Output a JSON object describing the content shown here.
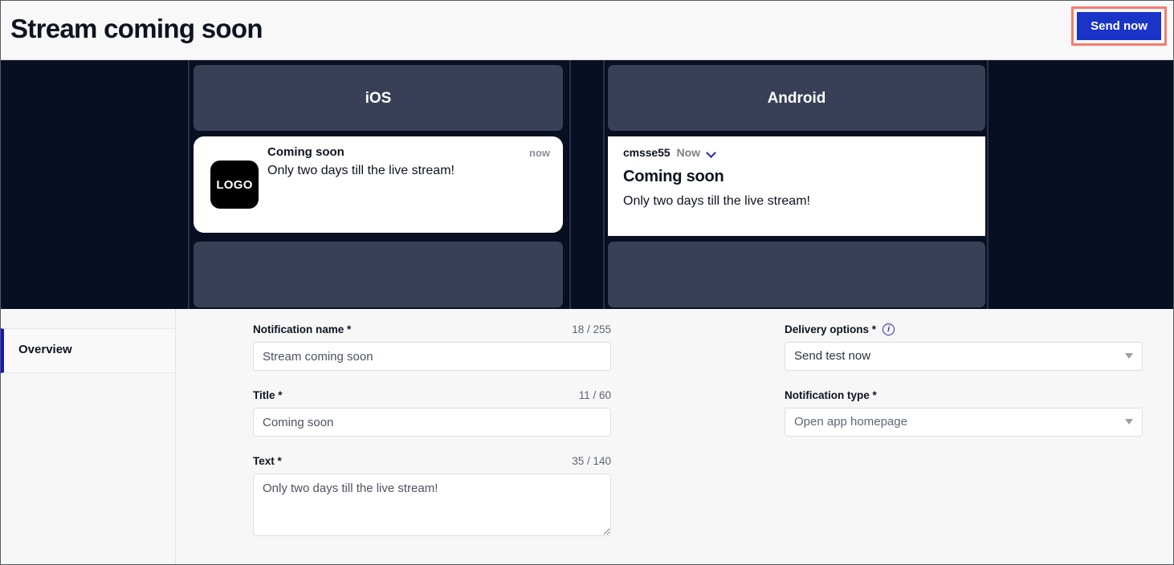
{
  "header": {
    "title": "Stream coming soon",
    "send_now_label": "Send now",
    "highlight_color": "#fa7a6e",
    "button_color": "#1a34c8"
  },
  "preview": {
    "ios": {
      "platform_label": "iOS",
      "logo_text": "LOGO",
      "title": "Coming soon",
      "time": "now",
      "body": "Only two days till the live stream!"
    },
    "android": {
      "platform_label": "Android",
      "app_name": "cmsse55",
      "time": "Now",
      "chevron_icon": "chevron-down-icon",
      "title": "Coming soon",
      "body": "Only two days till the live stream!"
    }
  },
  "sidebar": {
    "items": [
      {
        "label": "Overview",
        "active": true
      }
    ]
  },
  "form": {
    "left": [
      {
        "label": "Notification name *",
        "counter": "18 / 255",
        "value": "Stream coming soon",
        "type": "text"
      },
      {
        "label": "Title *",
        "counter": "11 / 60",
        "value": "Coming soon",
        "type": "text"
      },
      {
        "label": "Text *",
        "counter": "35 / 140",
        "value": "Only two days till the live stream!",
        "type": "textarea"
      }
    ],
    "right": [
      {
        "label": "Delivery options *",
        "info_icon": "info-icon",
        "value": "Send test now",
        "type": "select"
      },
      {
        "label": "Notification type *",
        "value": "Open app homepage",
        "type": "select"
      }
    ]
  }
}
